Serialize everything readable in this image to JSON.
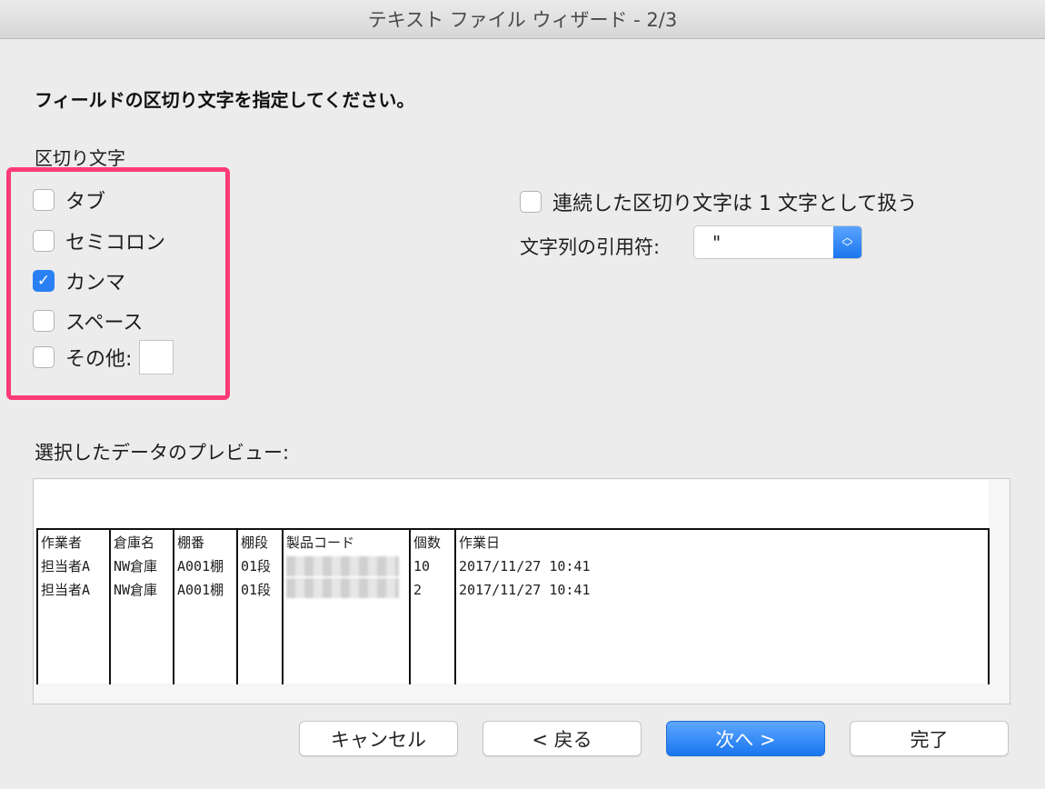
{
  "window": {
    "title": "テキスト ファイル ウィザード - 2/3"
  },
  "instruction": "フィールドの区切り文字を指定してください。",
  "delimiters": {
    "label": "区切り文字",
    "highlight_color": "#ff3b77",
    "items": [
      {
        "label": "タブ",
        "checked": false
      },
      {
        "label": "セミコロン",
        "checked": false
      },
      {
        "label": "カンマ",
        "checked": true
      },
      {
        "label": "スペース",
        "checked": false
      },
      {
        "label": "その他:",
        "checked": false,
        "value": ""
      }
    ]
  },
  "consecutive": {
    "label": "連続した区切り文字は 1 文字として扱う",
    "checked": false
  },
  "text_qualifier": {
    "label": "文字列の引用符:",
    "value": "\""
  },
  "preview": {
    "label": "選択したデータのプレビュー:",
    "columns": [
      "作業者",
      "倉庫名",
      "棚番",
      "棚段",
      "製品コード",
      "個数",
      "作業日"
    ],
    "rows": [
      [
        "担当者A",
        "NW倉庫",
        "A001棚",
        "01段",
        "",
        "10",
        "2017/11/27 10:41"
      ],
      [
        "担当者A",
        "NW倉庫",
        "A001棚",
        "01段",
        "",
        "2",
        "2017/11/27 10:41"
      ]
    ]
  },
  "buttons": {
    "cancel": "キャンセル",
    "back": "< 戻る",
    "next": "次へ >",
    "finish": "完了"
  },
  "colors": {
    "accent": "#2a80f3",
    "highlight": "#ff3b77"
  }
}
